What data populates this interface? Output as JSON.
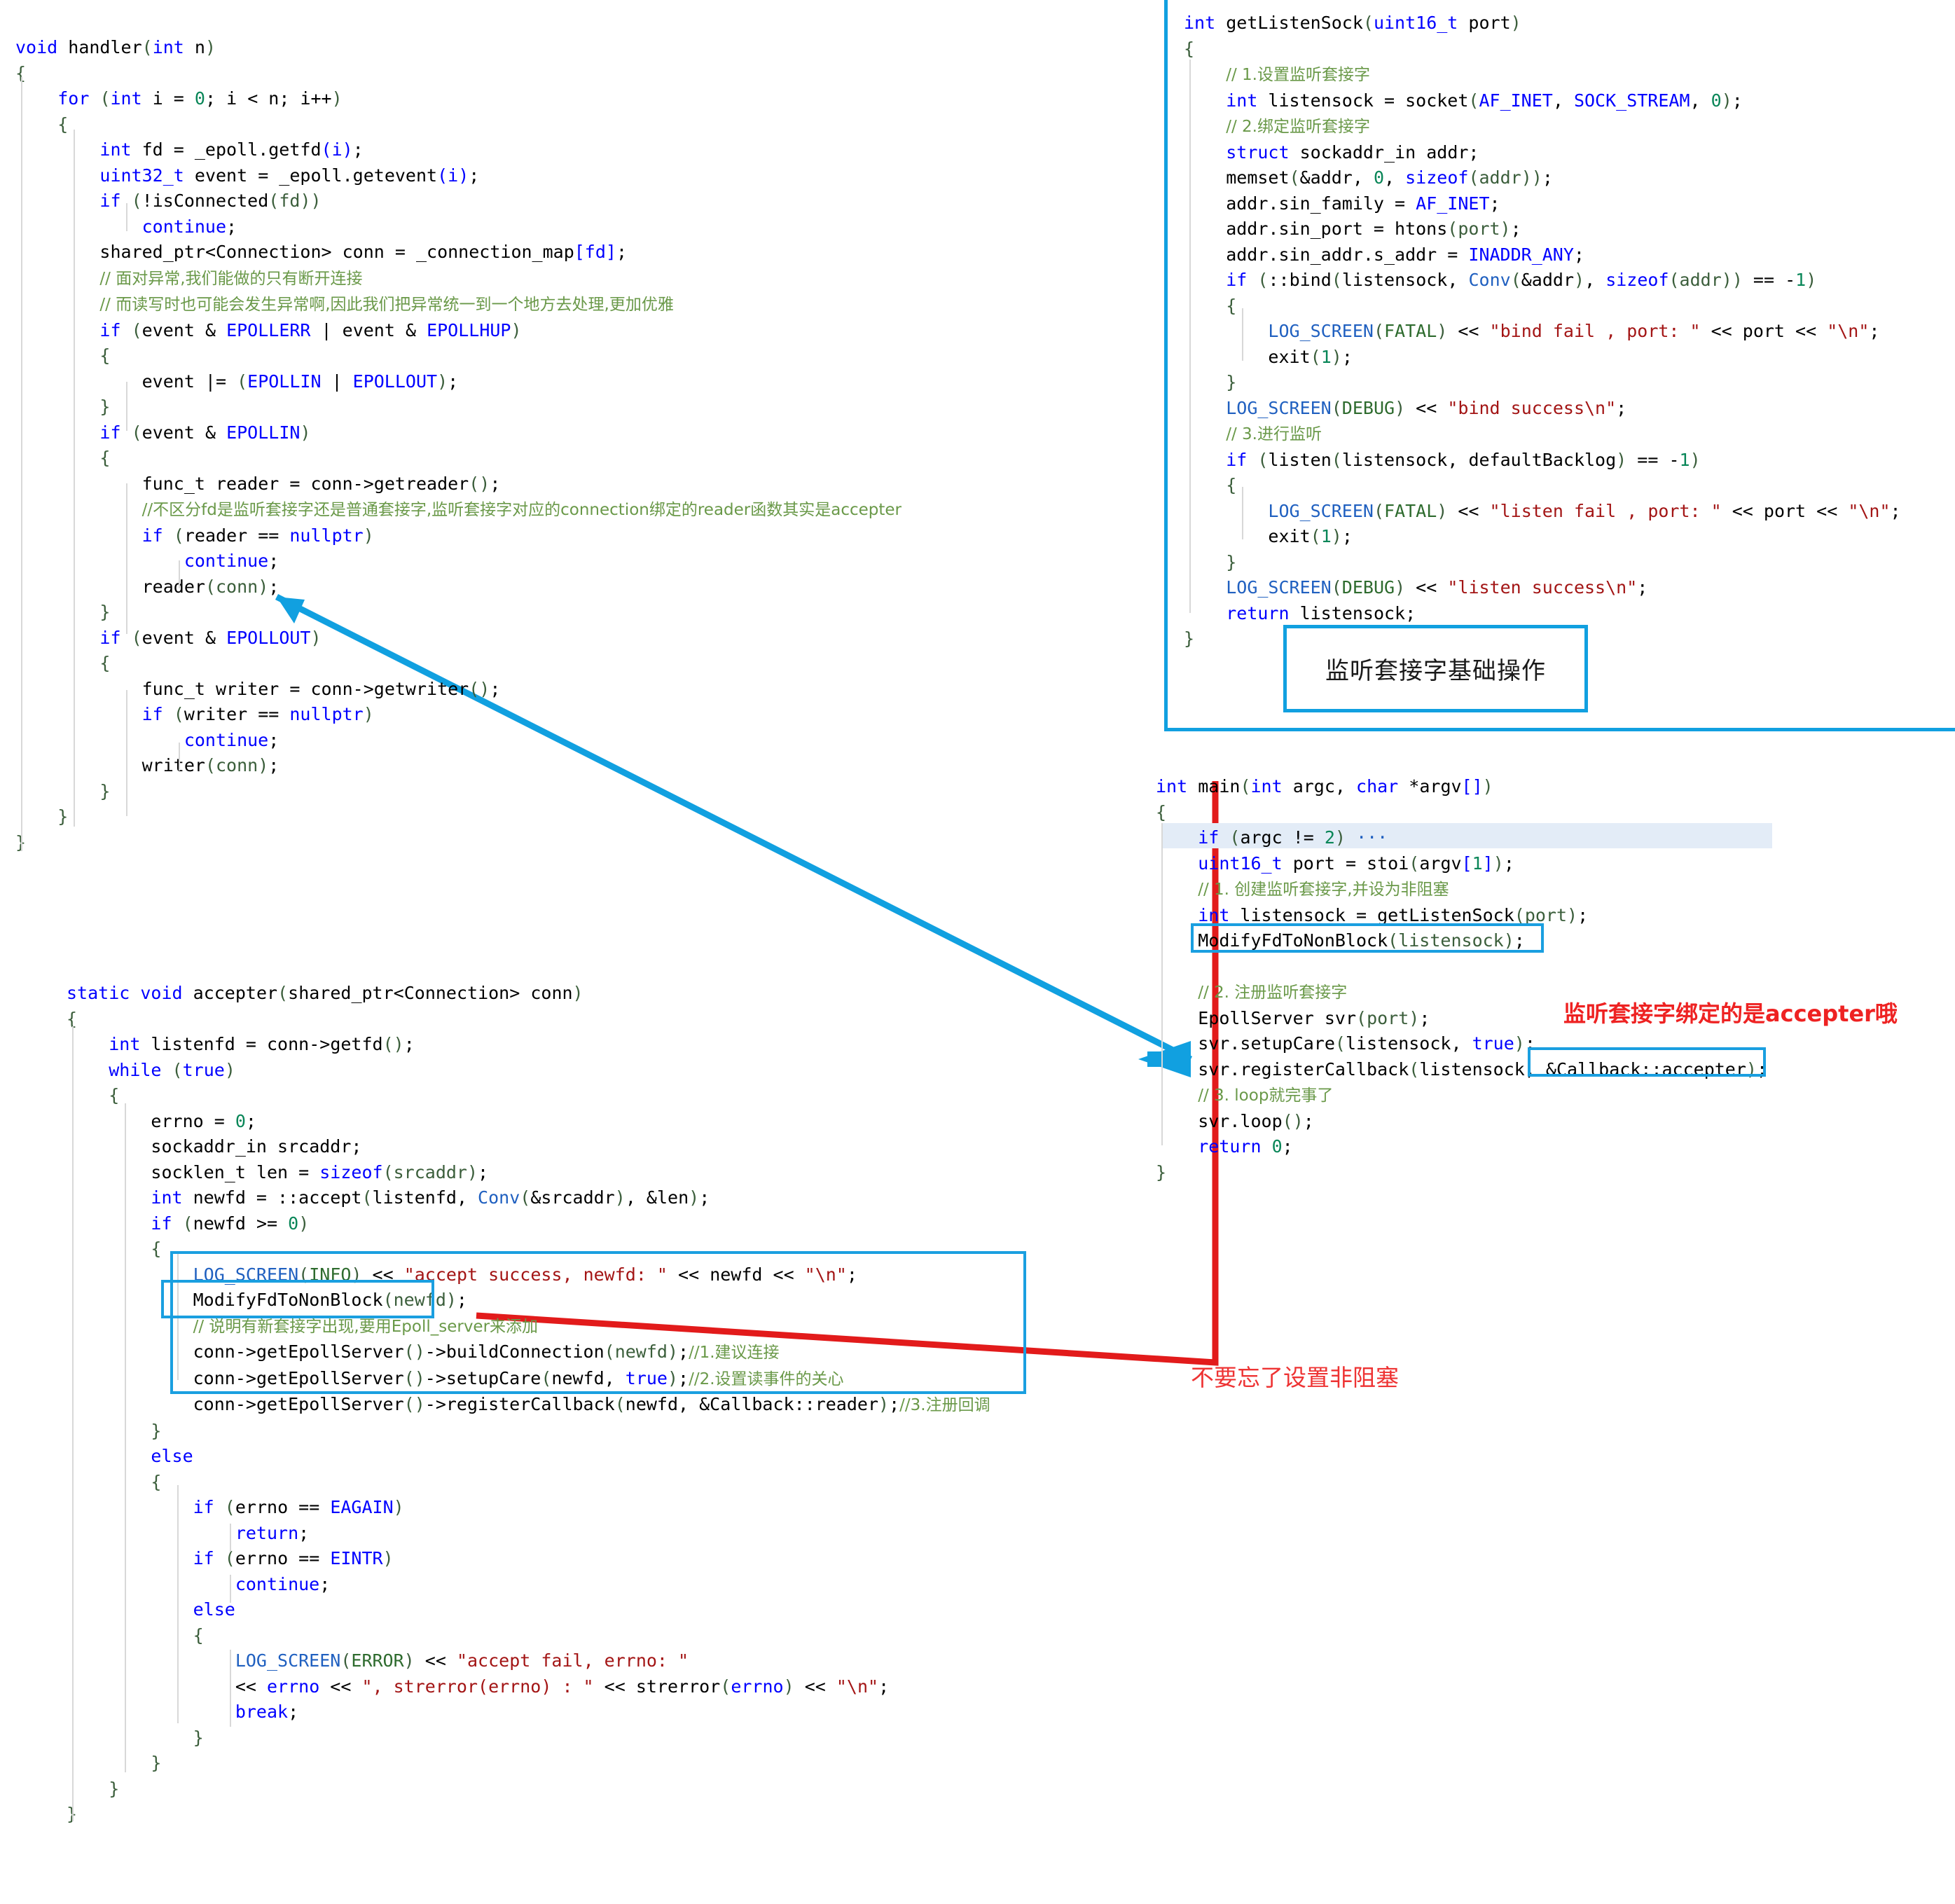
{
  "document": {
    "title": "Epoll server code annotation screenshot",
    "language": "cpp"
  },
  "blocks": {
    "handler": {
      "name": "handler-code-block",
      "lines": [
        "void handler(int n)",
        "{",
        "    for (int i = 0; i < n; i++)",
        "    {",
        "        int fd = _epoll.getfd(i);",
        "        uint32_t event = _epoll.getevent(i);",
        "        if (!isConnected(fd))",
        "            continue;",
        "        shared_ptr<Connection> conn = _connection_map[fd];",
        "        // 面对异常,我们能做的只有断开连接",
        "        // 而读写时也可能会发生异常啊,因此我们把异常统一到一个地方去处理,更加优雅",
        "        if (event & EPOLLERR | event & EPOLLHUP)",
        "        {",
        "            event |= (EPOLLIN | EPOLLOUT);",
        "        }",
        "        if (event & EPOLLIN)",
        "        {",
        "            func_t reader = conn->getreader();",
        "            //不区分fd是监听套接字还是普通套接字,监听套接字对应的connection绑定的reader函数其实是accepter",
        "            if (reader == nullptr)",
        "                continue;",
        "            reader(conn);",
        "        }",
        "        if (event & EPOLLOUT)",
        "        {",
        "            func_t writer = conn->getwriter();",
        "            if (writer == nullptr)",
        "                continue;",
        "            writer(conn);",
        "        }",
        "    }",
        "}"
      ]
    },
    "accepter": {
      "name": "accepter-code-block",
      "lines": [
        "static void accepter(shared_ptr<Connection> conn)",
        "{",
        "    int listenfd = conn->getfd();",
        "    while (true)",
        "    {",
        "        errno = 0;",
        "        sockaddr_in srcaddr;",
        "        socklen_t len = sizeof(srcaddr);",
        "        int newfd = ::accept(listenfd, Conv(&srcaddr), &len);",
        "        if (newfd >= 0)",
        "        {",
        "            LOG_SCREEN(INFO) << \"accept success, newfd: \" << newfd << \"\\n\";",
        "            ModifyFdToNonBlock(newfd);",
        "            // 说明有新套接字出现,要用Epoll_server来添加",
        "            conn->getEpollServer()->buildConnection(newfd);//1.建议连接",
        "            conn->getEpollServer()->setupCare(newfd, true);//2.设置读事件的关心",
        "            conn->getEpollServer()->registerCallback(newfd, &Callback::reader);//3.注册回调",
        "        }",
        "        else",
        "        {",
        "            if (errno == EAGAIN)",
        "                return;",
        "            if (errno == EINTR)",
        "                continue;",
        "            else",
        "            {",
        "                LOG_SCREEN(ERROR) << \"accept fail, errno: \"",
        "                << errno << \", strerror(errno) : \" << strerror(errno) << \"\\n\";",
        "                break;",
        "            }",
        "        }",
        "    }",
        "}"
      ]
    },
    "getlistensock": {
      "name": "getlistensock-code-block",
      "lines": [
        "int getListenSock(uint16_t port)",
        "{",
        "    // 1.设置监听套接字",
        "    int listensock = socket(AF_INET, SOCK_STREAM, 0);",
        "    // 2.绑定监听套接字",
        "    struct sockaddr_in addr;",
        "    memset(&addr, 0, sizeof(addr));",
        "    addr.sin_family = AF_INET;",
        "    addr.sin_port = htons(port);",
        "    addr.sin_addr.s_addr = INADDR_ANY;",
        "    if (::bind(listensock, Conv(&addr), sizeof(addr)) == -1)",
        "    {",
        "        LOG_SCREEN(FATAL) << \"bind fail , port: \" << port << \"\\n\";",
        "        exit(1);",
        "    }",
        "    LOG_SCREEN(DEBUG) << \"bind success\\n\";",
        "    // 3.进行监听",
        "    if (listen(listensock, defaultBacklog) == -1)",
        "    {",
        "        LOG_SCREEN(FATAL) << \"listen fail , port: \" << port << \"\\n\";",
        "        exit(1);",
        "    }",
        "    LOG_SCREEN(DEBUG) << \"listen success\\n\";",
        "    return listensock;",
        "}"
      ]
    },
    "main": {
      "name": "main-code-block",
      "lines": [
        "int main(int argc, char *argv[])",
        "{",
        "    if (argc != 2) ···",
        "    uint16_t port = stoi(argv[1]);",
        "    // 1. 创建监听套接字,并设为非阻塞",
        "    int listensock = getListenSock(port);",
        "    ModifyFdToNonBlock(listensock);",
        "",
        "    // 2. 注册监听套接字",
        "    EpollServer svr(port);",
        "    svr.setupCare(listensock, true);",
        "    svr.registerCallback(listensock, &Callback::accepter);",
        "    // 3. loop就完事了",
        "    svr.loop();",
        "    return 0;",
        "}"
      ]
    }
  },
  "annotations": {
    "listen_socket_basic_ops": "监听套接字基础操作",
    "accepter_binding_note": "监听套接字绑定的是accepter哦",
    "nonblock_note": "不要忘了设置非阻塞"
  },
  "colors": {
    "annotation_blue": "#11a0e0",
    "annotation_red": "#ee2222",
    "keyword": "#0000ff",
    "comment": "#6a9949",
    "string": "#a31515",
    "number": "#098658",
    "macro": "#2060c0"
  }
}
